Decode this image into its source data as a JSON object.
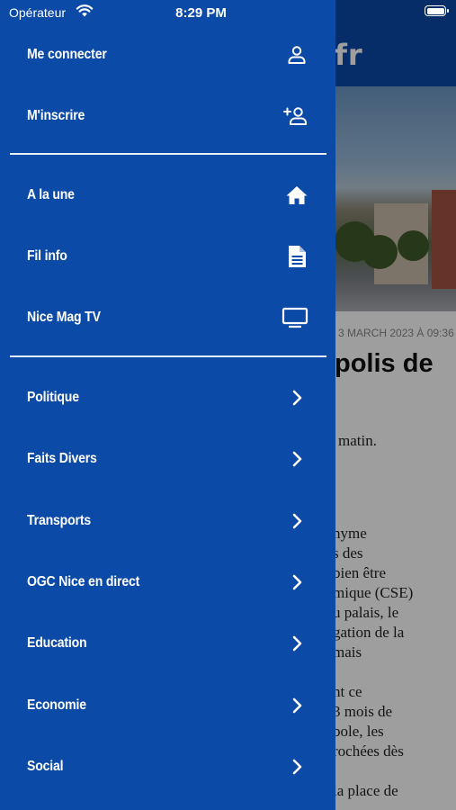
{
  "status_bar": {
    "carrier": "Opérateur",
    "time": "8:29 PM"
  },
  "background_article": {
    "logo_text": "fr",
    "date_fragment": "3 MARCH 2023 À 09:36",
    "title_fragment": "polis de",
    "lead_fragment": "matin.",
    "body_lines": [
      "nyme",
      "s des",
      "bien être",
      "mique (CSE)",
      "u palais, le",
      "gation de la",
      "mais",
      "",
      "nt ce",
      "3 mois de",
      "bole, les",
      "rochées dès",
      "",
      "la place de"
    ]
  },
  "drawer": {
    "account": [
      {
        "label": "Me connecter",
        "icon": "user-icon"
      },
      {
        "label": "M'inscrire",
        "icon": "user-add-icon"
      }
    ],
    "main": [
      {
        "label": "A la une",
        "icon": "home-icon"
      },
      {
        "label": "Fil info",
        "icon": "document-icon"
      },
      {
        "label": "Nice Mag TV",
        "icon": "tv-icon"
      }
    ],
    "categories": [
      {
        "label": "Politique",
        "icon": "chevron-right-icon"
      },
      {
        "label": "Faits Divers",
        "icon": "chevron-right-icon"
      },
      {
        "label": "Transports",
        "icon": "chevron-right-icon"
      },
      {
        "label": "OGC Nice en direct",
        "icon": "chevron-right-icon"
      },
      {
        "label": "Education",
        "icon": "chevron-right-icon"
      },
      {
        "label": "Economie",
        "icon": "chevron-right-icon"
      },
      {
        "label": "Social",
        "icon": "chevron-right-icon"
      }
    ]
  },
  "colors": {
    "drawer_bg": "#0b4aa6",
    "text": "#ffffff",
    "divider": "#e8eef8"
  }
}
